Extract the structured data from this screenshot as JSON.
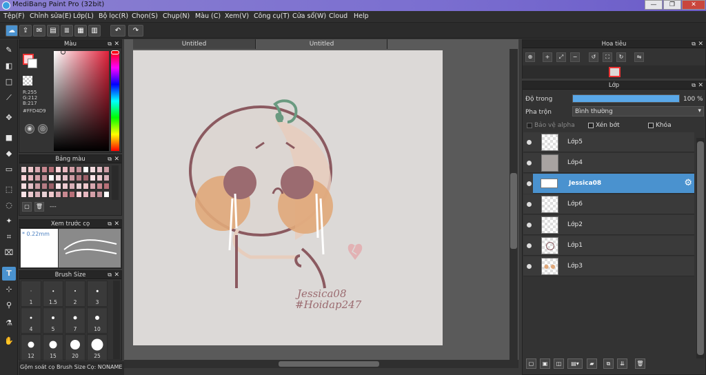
{
  "window": {
    "title": "MediBang Paint Pro (32bit)",
    "minimize": "—",
    "restore": "❐",
    "close": "✕"
  },
  "menu": [
    "Tệp(F)",
    "Chỉnh sửa(E)",
    "Lớp(L)",
    "Bộ lọc(R)",
    "Chọn(S)",
    "Chụp(N)",
    "Màu (C)",
    "Xem(V)",
    "Công cụ(T)",
    "Cửa sổ(W)",
    "Cloud",
    "Help"
  ],
  "toolbar_icons": [
    "cloud-icon",
    "export-icon",
    "chat-icon",
    "document-icon",
    "list-icon",
    "grid-icon",
    "panels-icon",
    "undo-icon",
    "redo-icon"
  ],
  "tools": [
    "brush-icon",
    "eraser-icon",
    "rectangle-icon",
    "pen-icon",
    "move-icon",
    "fill-rect-icon",
    "bucket-icon",
    "gradient-icon",
    "select-rect-icon",
    "lasso-icon",
    "magic-wand-icon",
    "select-pen-icon",
    "select-eraser-icon",
    "text-icon",
    "divide-icon",
    "eyedropper-icon",
    "dropper-icon",
    "hand-icon"
  ],
  "color_panel": {
    "title": "Màu",
    "r": "R:255",
    "g": "G:212",
    "b": "B:217",
    "hex": "#FFD4D9",
    "fg_color": "#ffd4d9",
    "bg_color": "#ffffff"
  },
  "swatch_panel": {
    "title": "Bảng màu",
    "dash": "---"
  },
  "brush_preview": {
    "title": "Xem trước cọ",
    "size": "0.22mm"
  },
  "brush_size": {
    "title": "Brush Size",
    "sizes": [
      "1",
      "1.5",
      "2",
      "3",
      "4",
      "5",
      "7",
      "10",
      "12",
      "15",
      "20",
      "25"
    ]
  },
  "bottom_tabs": [
    "Gộm soát cọ",
    "Brush Size",
    "Cọ: NONAME"
  ],
  "canvas": {
    "tabs": [
      "Untitled",
      "Untitled"
    ],
    "signature": "Jessica08",
    "hashtag": "#Hoidap247"
  },
  "navigator": {
    "title": "Hoa tiêu"
  },
  "layer_panel": {
    "title": "Lớp",
    "opacity_label": "Độ trong",
    "opacity_value": "100 %",
    "opacity": 1.0,
    "blend_label": "Pha trộn",
    "blend_value": "Bình thường",
    "protect_alpha": "Bảo vệ alpha",
    "clip": "Xén bớt",
    "lock": "Khóa",
    "layers": [
      "Lớp5",
      "Lớp4",
      "Jessica08",
      "Lớp6",
      "Lớp2",
      "Lớp1",
      "Lớp3"
    ],
    "selected": "Jessica08"
  },
  "colors": {
    "accent": "#4a92cf",
    "pink": "#ffd4d9",
    "outline": "#8b5a60",
    "cheek": "#e0a87a",
    "eye": "#9b6b70",
    "sprout": "#6a9a80"
  }
}
